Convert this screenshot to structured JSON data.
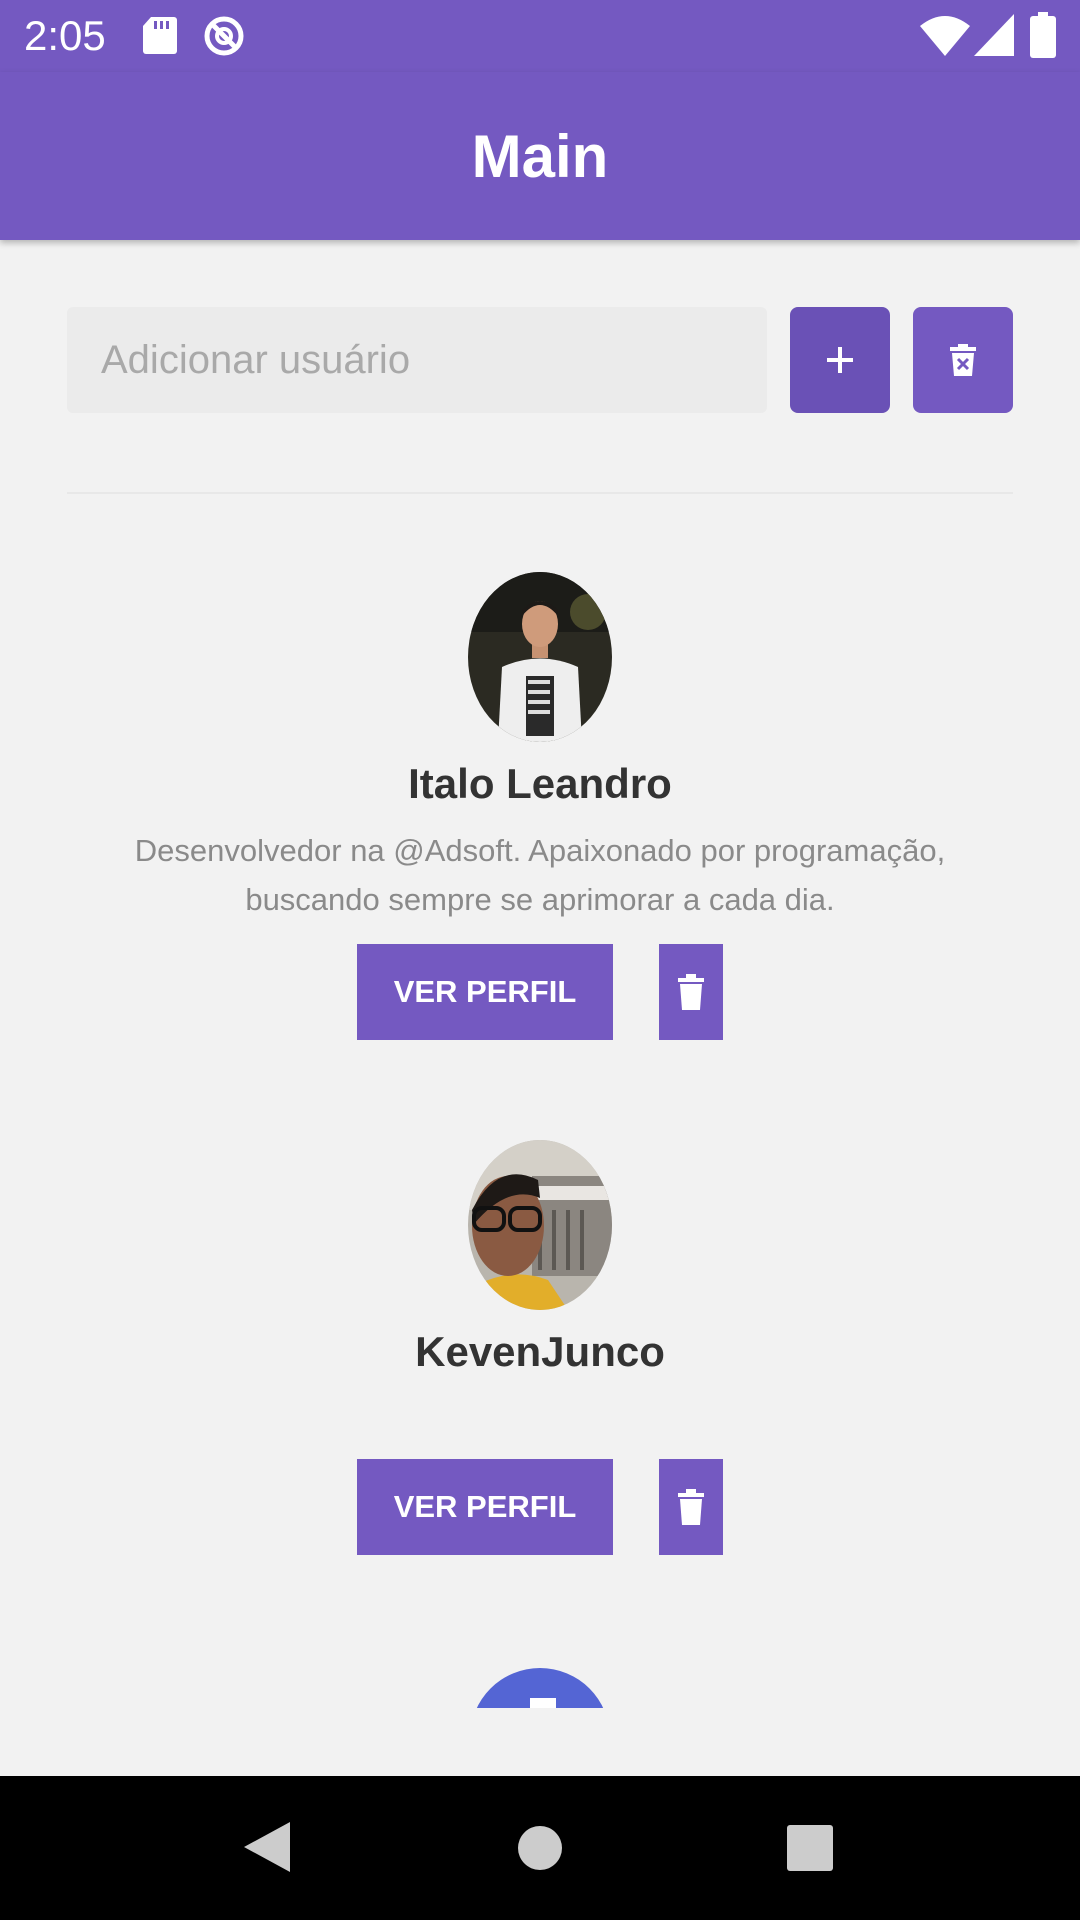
{
  "status_bar": {
    "time": "2:05",
    "icons": [
      "sd-card-icon",
      "sync-disabled-icon",
      "wifi-icon",
      "signal-icon",
      "battery-icon"
    ]
  },
  "app_bar": {
    "title": "Main"
  },
  "search": {
    "placeholder": "Adicionar usuário",
    "value": "",
    "add_icon": "plus-icon",
    "clear_icon": "delete-forever-icon"
  },
  "users": [
    {
      "name": "Italo Leandro",
      "bio": "Desenvolvedor na @Adsoft. Apaixonado por programação, buscando sempre se aprimorar a cada dia.",
      "view_label": "VER PERFIL",
      "delete_icon": "trash-icon"
    },
    {
      "name": "KevenJunco",
      "bio": "",
      "view_label": "VER PERFIL",
      "delete_icon": "trash-icon"
    }
  ],
  "nav_bar": {
    "buttons": [
      "back-icon",
      "home-icon",
      "recents-icon"
    ]
  },
  "colors": {
    "primary": "#7459c1",
    "primary_dark": "#6a51b6",
    "background": "#f2f2f2",
    "name_text": "#333333",
    "bio_text": "#8a8a8a",
    "input_background": "#ebebeb"
  }
}
